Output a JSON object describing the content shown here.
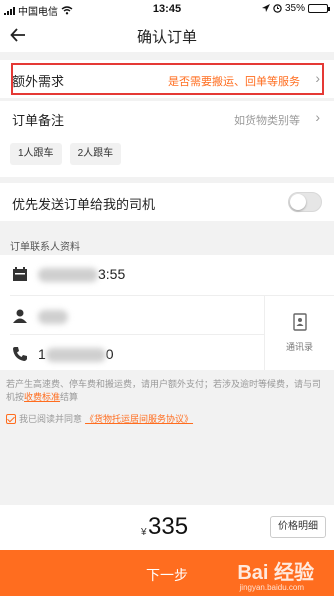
{
  "status": {
    "carrier": "中国电信",
    "time": "13:45",
    "battery": "35%",
    "battery_level": 0.35
  },
  "nav": {
    "title": "确认订单"
  },
  "extra": {
    "title": "额外需求",
    "hint": "是否需要搬运、回单等服务",
    "accent": "#ff6d1f",
    "highlight": "#e53935"
  },
  "remark": {
    "title": "订单备注",
    "hint": "如货物类别等",
    "tags": [
      "1人跟车",
      "2人跟车"
    ]
  },
  "priority": {
    "title": "优先发送订单给我的司机",
    "enabled": false
  },
  "contact": {
    "label": "订单联系人资料",
    "time_suffix": "3:55",
    "phone_prefix": "1",
    "phone_suffix": "0",
    "address_book": "通讯录"
  },
  "notice": {
    "text": "若产生高速费、停车费和搬运费，请用户额外支付；若涉及逾时等候费，请与司机按",
    "link": "收费标准",
    "tail": "结算"
  },
  "agree": {
    "prefix": "我已阅读并同意",
    "link": "《货物托运居间服务协议》"
  },
  "price": {
    "currency": "¥",
    "amount": "335",
    "detail": "价格明细"
  },
  "next": {
    "label": "下一步"
  },
  "watermark": {
    "brand": "Bai 经验",
    "url": "jingyan.baidu.com"
  }
}
